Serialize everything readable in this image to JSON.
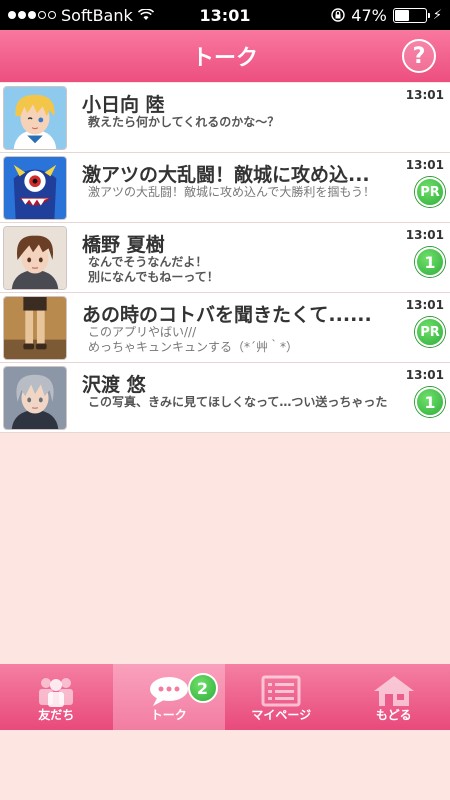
{
  "status_bar": {
    "carrier": "SoftBank",
    "time": "13:01",
    "battery": "47%",
    "battery_level": 0.47,
    "signal_bars": 3
  },
  "header": {
    "title": "トーク",
    "help_label": "?"
  },
  "talks": [
    {
      "name": "小日向 陸",
      "preview": "教えたら何かしてくれるのかな～？",
      "time": "13:01",
      "badge": "",
      "is_ad": false,
      "avatar_icon": "blond-boy-avatar"
    },
    {
      "name": "激アツの大乱闘！敵城に攻め込...",
      "preview": "激アツの大乱闘！敵城に攻め込んで大勝利を掴もう！",
      "time": "13:01",
      "badge": "PR",
      "is_ad": true,
      "avatar_icon": "blue-monster-avatar"
    },
    {
      "name": "橋野 夏樹",
      "preview": "なんでそうなんだよ！\n別になんでもねーって！",
      "time": "13:01",
      "badge": "1",
      "is_ad": false,
      "avatar_icon": "brown-hair-boy-avatar"
    },
    {
      "name": "あの時のコトバを聞きたくて......",
      "preview": "このアプリやばい///\nめっちゃキュンキュンする（*´艸｀*）",
      "time": "13:01",
      "badge": "PR",
      "is_ad": true,
      "avatar_icon": "legs-photo-avatar"
    },
    {
      "name": "沢渡 悠",
      "preview": "この写真、きみに見てほしくなって…つい送っちゃった",
      "time": "13:01",
      "badge": "1",
      "is_ad": false,
      "avatar_icon": "grey-hair-boy-avatar"
    }
  ],
  "tabs": [
    {
      "label": "友だち",
      "icon": "people-icon",
      "active": false
    },
    {
      "label": "トーク",
      "icon": "chat-bubble-icon",
      "active": true,
      "badge": "2"
    },
    {
      "label": "マイページ",
      "icon": "list-icon",
      "active": false
    },
    {
      "label": "もどる",
      "icon": "home-icon",
      "active": false
    }
  ],
  "colors": {
    "accent": "#ec4f80",
    "background": "#fde6e1",
    "badge_green": "#2fae3a"
  }
}
